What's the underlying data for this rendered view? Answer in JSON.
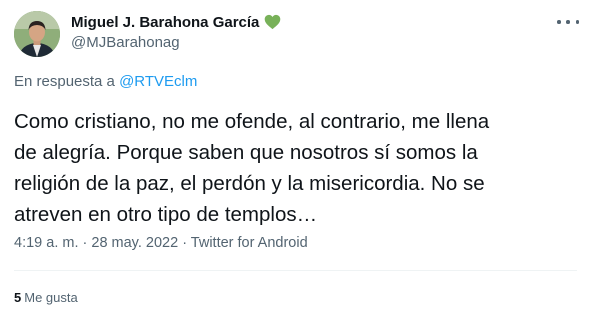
{
  "author": {
    "display_name": "Miguel J. Barahona García",
    "handle": "@MJBarahonag",
    "badge_icon": "green-heart-icon",
    "badge_color": "#78b159"
  },
  "reply": {
    "prefix": "En respuesta a ",
    "mention": "@RTVEclm"
  },
  "tweet_text": "Como cristiano, no me ofende, al contrario, me llena\nde alegría. Porque saben que nosotros sí somos la\nreligión de la paz, el perdón y la misericordia. No se\natreven en otro tipo de templos…",
  "meta": {
    "time": "4:19 a. m.",
    "separator": " · ",
    "date": "28 may. 2022",
    "source": "Twitter for Android"
  },
  "stats": {
    "likes_count": "5",
    "likes_label": "Me gusta"
  },
  "colors": {
    "text": "#0f1419",
    "secondary": "#536471",
    "link": "#1d9bf0",
    "divider": "#eff3f4"
  }
}
